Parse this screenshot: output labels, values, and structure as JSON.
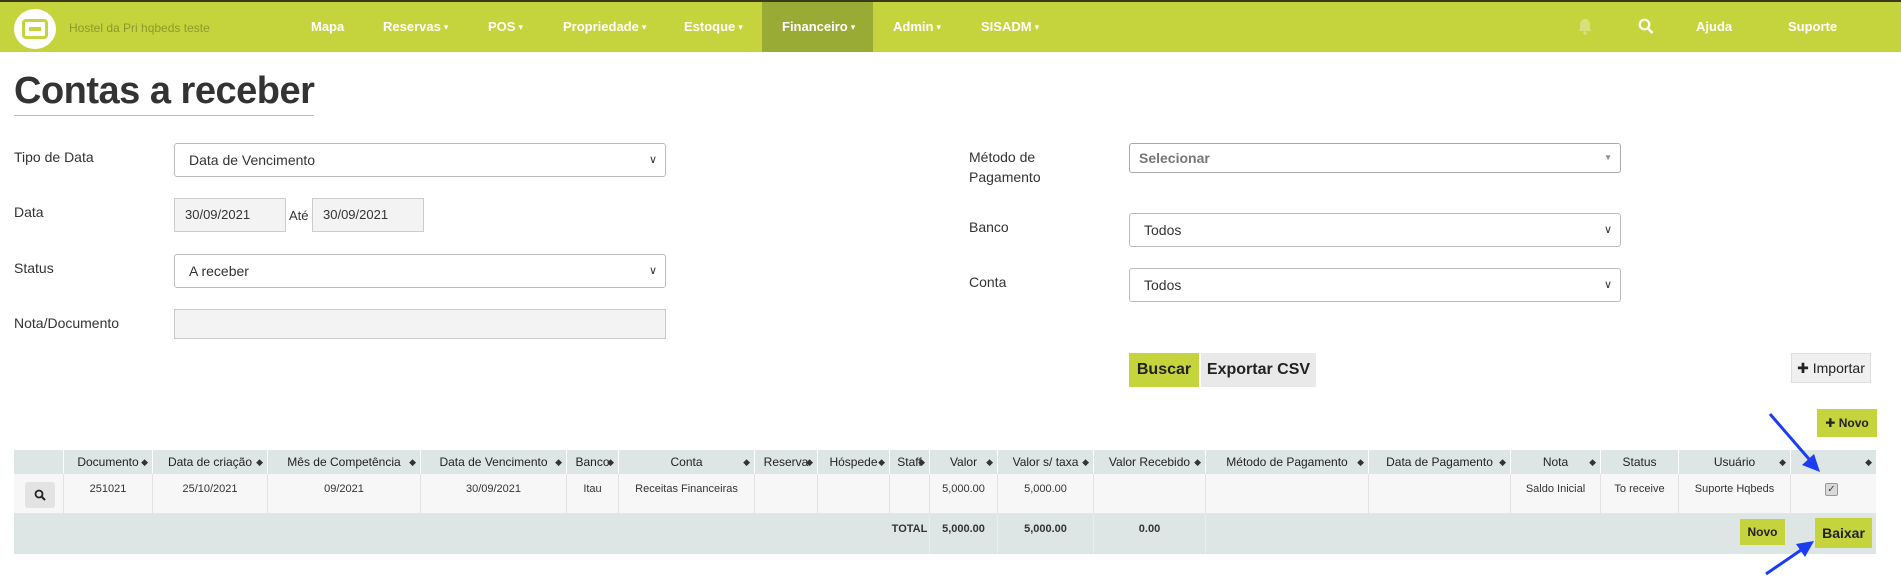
{
  "navbar": {
    "brand": "Hostel da Pri hqbeds teste",
    "items": [
      {
        "label": "Mapa",
        "dropdown": false,
        "active": false
      },
      {
        "label": "Reservas",
        "dropdown": true,
        "active": false
      },
      {
        "label": "POS",
        "dropdown": true,
        "active": false
      },
      {
        "label": "Propriedade",
        "dropdown": true,
        "active": false
      },
      {
        "label": "Estoque",
        "dropdown": true,
        "active": false
      },
      {
        "label": "Financeiro",
        "dropdown": true,
        "active": true
      },
      {
        "label": "Admin",
        "dropdown": true,
        "active": false
      },
      {
        "label": "SISADM",
        "dropdown": true,
        "active": false
      }
    ],
    "help_label": "Ajuda",
    "support_label": "Suporte",
    "accent_color": "#c5d43c",
    "active_color": "#9aab35"
  },
  "page": {
    "title": "Contas a receber"
  },
  "filters": {
    "date_type_label": "Tipo de Data",
    "date_type_value": "Data de Vencimento",
    "date_label": "Data",
    "date_from": "30/09/2021",
    "date_until_label": "Até",
    "date_to": "30/09/2021",
    "status_label": "Status",
    "status_value": "A receber",
    "note_label": "Nota/Documento",
    "note_value": "",
    "payment_method_label": "Método de Pagamento",
    "payment_method_placeholder": "Selecionar",
    "bank_label": "Banco",
    "bank_value": "Todos",
    "account_label": "Conta",
    "account_value": "Todos"
  },
  "actions": {
    "search_label": "Buscar",
    "export_label": "Exportar CSV",
    "import_label": "Importar",
    "new_label": "Novo"
  },
  "table": {
    "columns": [
      "",
      "Documento",
      "Data de criação",
      "Mês de Competência",
      "Data de Vencimento",
      "Banco",
      "Conta",
      "Reserva",
      "Hóspede",
      "Staff",
      "Valor",
      "Valor s/ taxa",
      "Valor Recebido",
      "Método de Pagamento",
      "Data de Pagamento",
      "Nota",
      "Status",
      "Usuário",
      ""
    ],
    "rows": [
      {
        "documento": "251021",
        "data_criacao": "25/10/2021",
        "mes_competencia": "09/2021",
        "data_vencimento": "30/09/2021",
        "banco": "Itau",
        "conta": "Receitas Financeiras",
        "reserva": "",
        "hospede": "",
        "staff": "",
        "valor": "5,000.00",
        "valor_sem_taxa": "5,000.00",
        "valor_recebido": "",
        "metodo_pagamento": "",
        "data_pagamento": "",
        "nota": "Saldo Inicial",
        "status": "To receive",
        "usuario": "Suporte Hqbeds",
        "checked": true
      }
    ],
    "totals": {
      "label": "TOTAL",
      "valor": "5,000.00",
      "valor_sem_taxa": "5,000.00",
      "valor_recebido": "0.00",
      "new_label": "Novo",
      "write_off_label": "Baixar"
    }
  },
  "annotation_color": "#1a3df0"
}
